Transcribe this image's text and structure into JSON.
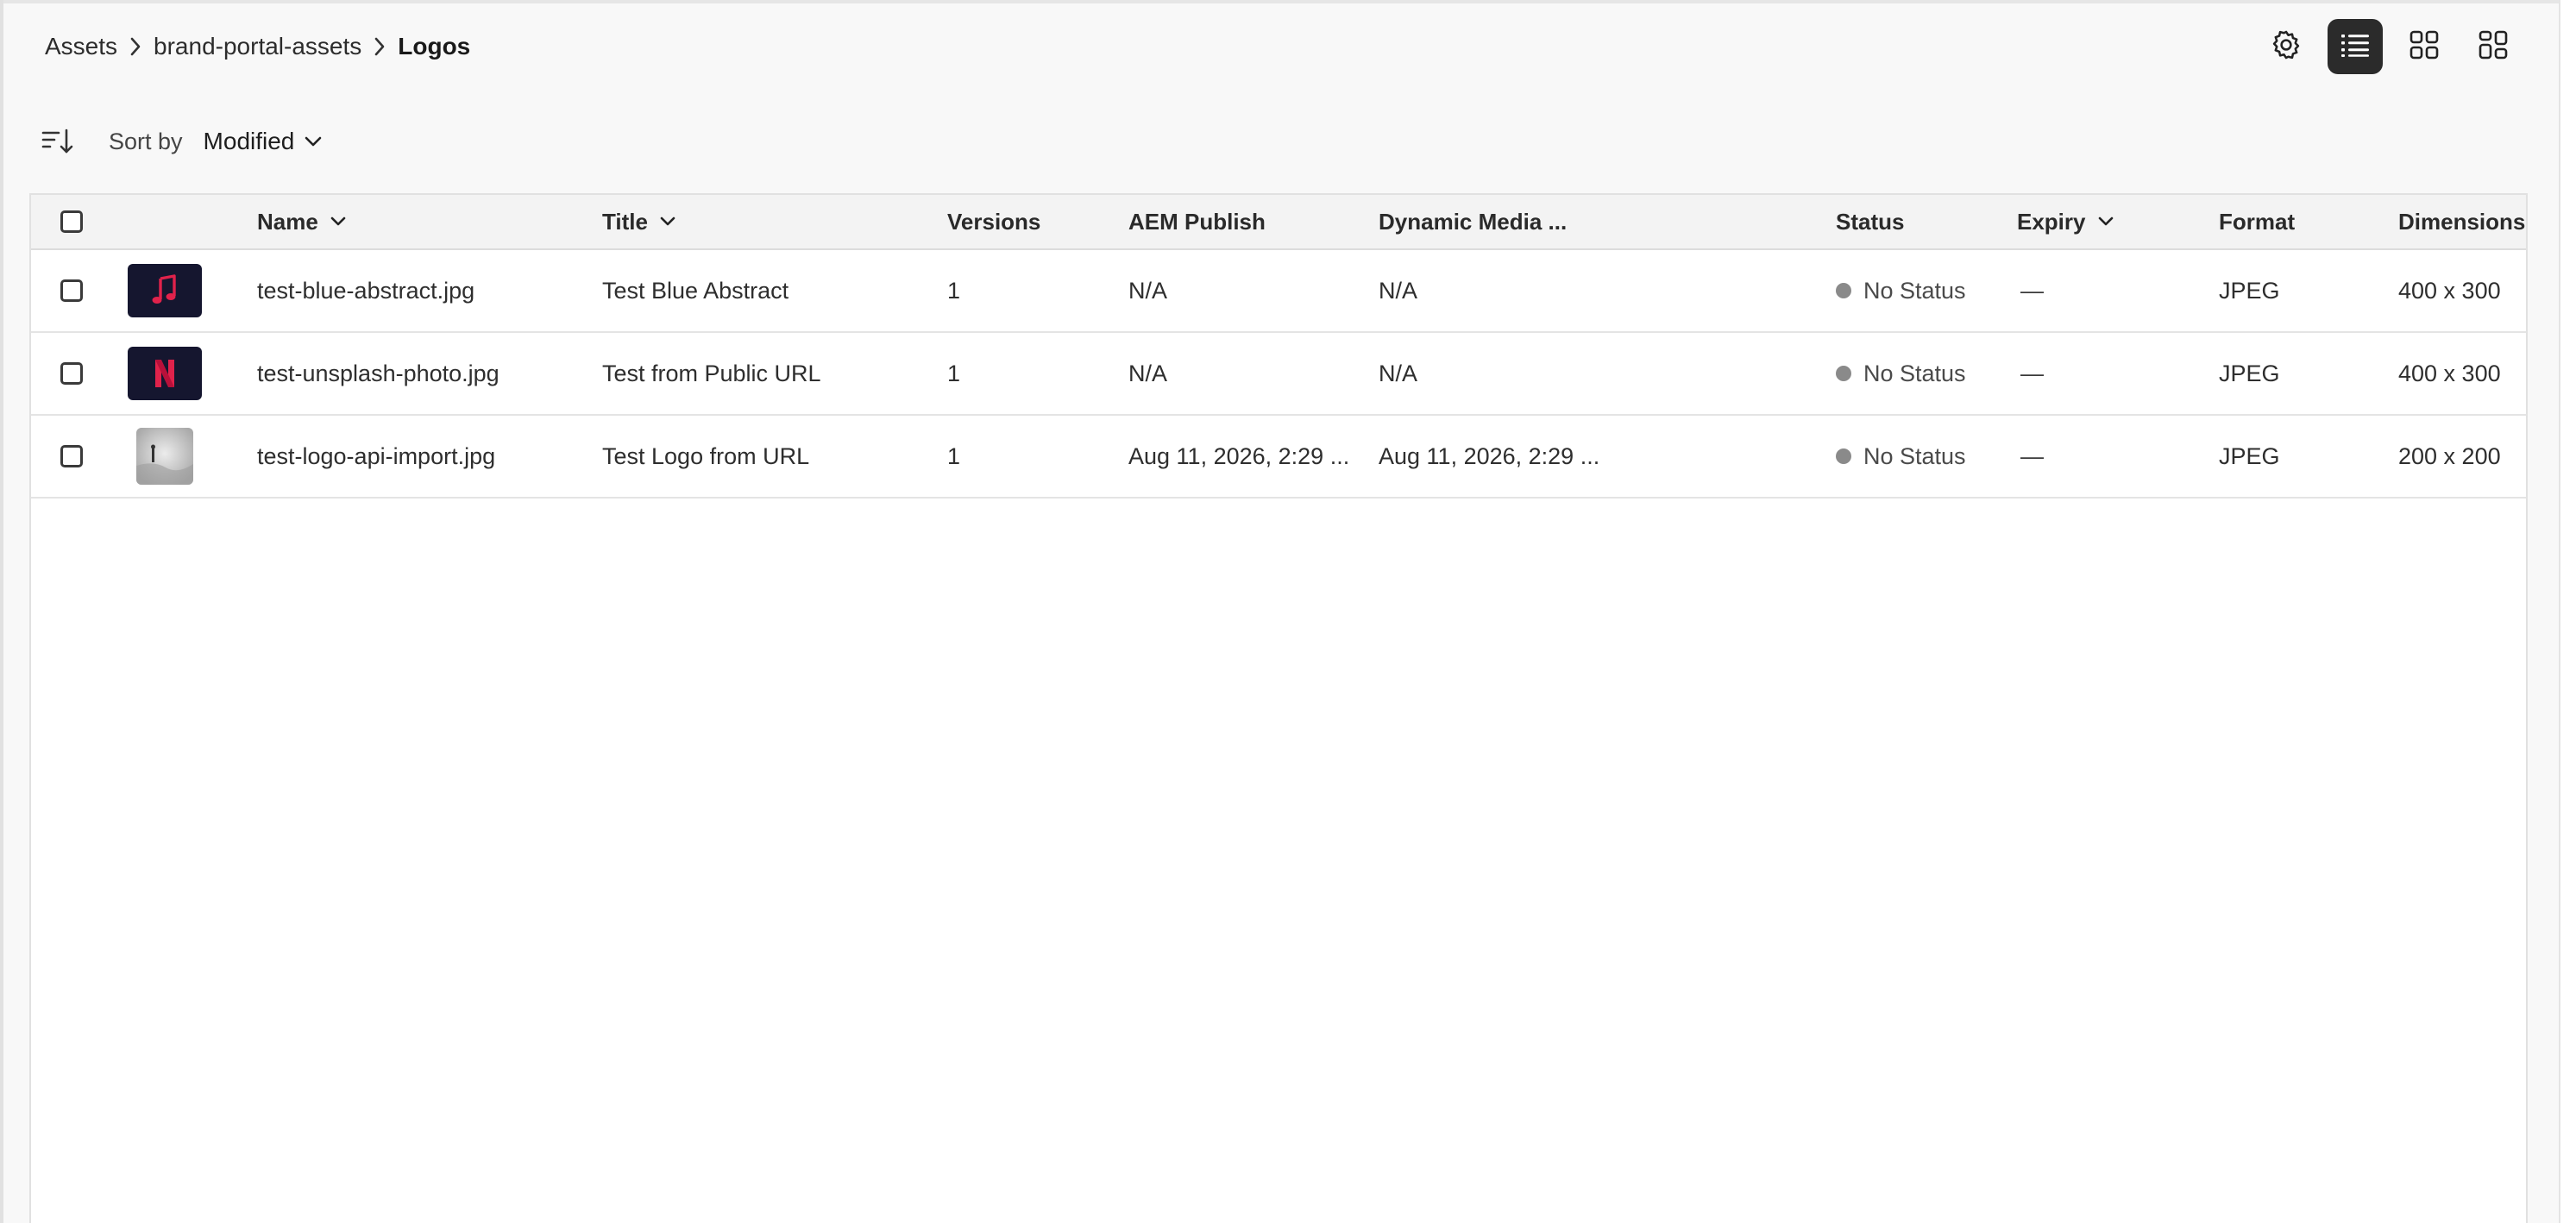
{
  "breadcrumb": [
    "Assets",
    "brand-portal-assets",
    "Logos"
  ],
  "toolbar": {
    "settings_icon": "gear-icon",
    "view_modes": [
      "list-view-icon",
      "grid-view-icon",
      "masonry-view-icon"
    ],
    "active_view": "list"
  },
  "sort": {
    "label": "Sort by",
    "value": "Modified"
  },
  "table": {
    "columns": [
      "Name",
      "Title",
      "Versions",
      "AEM Publish",
      "Dynamic Media ...",
      "Status",
      "Expiry",
      "Format",
      "Dimensions"
    ],
    "sortable_columns": [
      "Name",
      "Title",
      "Expiry"
    ],
    "rows": [
      {
        "thumbnail": "music-note-logo",
        "name": "test-blue-abstract.jpg",
        "title": "Test Blue Abstract",
        "versions": "1",
        "aem_publish": "N/A",
        "dynamic_media": "N/A",
        "status": "No Status",
        "expiry": "—",
        "format": "JPEG",
        "dimensions": "400 x 300"
      },
      {
        "thumbnail": "n-letter-logo",
        "name": "test-unsplash-photo.jpg",
        "title": "Test from Public URL",
        "versions": "1",
        "aem_publish": "N/A",
        "dynamic_media": "N/A",
        "status": "No Status",
        "expiry": "—",
        "format": "JPEG",
        "dimensions": "400 x 300"
      },
      {
        "thumbnail": "grayscale-photo",
        "name": "test-logo-api-import.jpg",
        "title": "Test Logo from URL",
        "versions": "1",
        "aem_publish": "Aug 11, 2026, 2:29 ...",
        "dynamic_media": "Aug 11, 2026, 2:29 ...",
        "status": "No Status",
        "expiry": "—",
        "format": "JPEG",
        "dimensions": "200 x 200"
      }
    ]
  },
  "colors": {
    "accent_dark": "#2b2b2b",
    "thumb_dark": "#15162f",
    "thumb_red": "#e0224b",
    "status_gray": "#8a8a8a"
  }
}
